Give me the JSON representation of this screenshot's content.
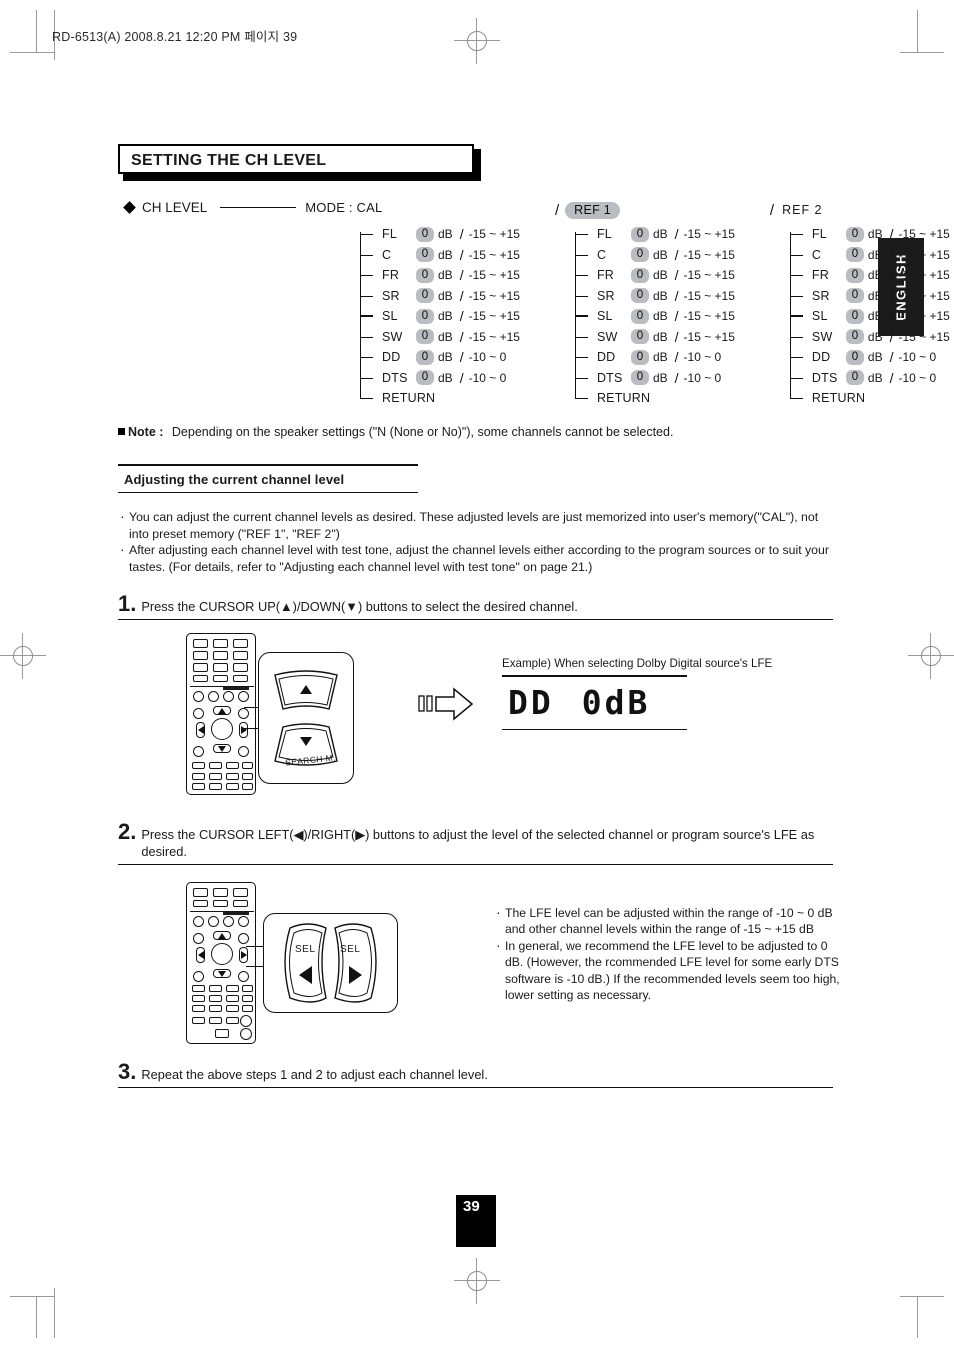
{
  "running_head": "RD-6513(A)  2008.8.21  12:20 PM  페이지 39",
  "section_title": "SETTING THE CH LEVEL",
  "side_tab": "ENGLISH",
  "ch_level": {
    "label": "CH LEVEL",
    "mode_label": "MODE  : CAL"
  },
  "columns": [
    {
      "header": "CAL",
      "header_style": "inline",
      "rows": [
        {
          "ch": "FL",
          "value": "0",
          "unit": "dB",
          "range": "-15 ~ +15"
        },
        {
          "ch": "C",
          "value": "0",
          "unit": "dB",
          "range": "-15 ~ +15"
        },
        {
          "ch": "FR",
          "value": "0",
          "unit": "dB",
          "range": "-15 ~ +15"
        },
        {
          "ch": "SR",
          "value": "0",
          "unit": "dB",
          "range": "-15 ~ +15"
        },
        {
          "ch": "SL",
          "value": "0",
          "unit": "dB",
          "range": "-15 ~ +15"
        },
        {
          "ch": "SW",
          "value": "0",
          "unit": "dB",
          "range": "-15 ~ +15"
        },
        {
          "ch": "DD",
          "value": "0",
          "unit": "dB",
          "range": "-10 ~ 0"
        },
        {
          "ch": "DTS",
          "value": "0",
          "unit": "dB",
          "range": "-10 ~ 0"
        }
      ],
      "return_label": "RETURN"
    },
    {
      "header": "REF 1",
      "header_style": "badge",
      "rows": [
        {
          "ch": "FL",
          "value": "0",
          "unit": "dB",
          "range": "-15 ~ +15"
        },
        {
          "ch": "C",
          "value": "0",
          "unit": "dB",
          "range": "-15 ~ +15"
        },
        {
          "ch": "FR",
          "value": "0",
          "unit": "dB",
          "range": "-15 ~ +15"
        },
        {
          "ch": "SR",
          "value": "0",
          "unit": "dB",
          "range": "-15 ~ +15"
        },
        {
          "ch": "SL",
          "value": "0",
          "unit": "dB",
          "range": "-15 ~ +15"
        },
        {
          "ch": "SW",
          "value": "0",
          "unit": "dB",
          "range": "-15 ~ +15"
        },
        {
          "ch": "DD",
          "value": "0",
          "unit": "dB",
          "range": "-10 ~ 0"
        },
        {
          "ch": "DTS",
          "value": "0",
          "unit": "dB",
          "range": "-10 ~ 0"
        }
      ],
      "return_label": "RETURN"
    },
    {
      "header": "REF 2",
      "header_style": "plain",
      "rows": [
        {
          "ch": "FL",
          "value": "0",
          "unit": "dB",
          "range": "-15 ~ +15"
        },
        {
          "ch": "C",
          "value": "0",
          "unit": "dB",
          "range": "-15 ~ +15"
        },
        {
          "ch": "FR",
          "value": "0",
          "unit": "dB",
          "range": "-15 ~ +15"
        },
        {
          "ch": "SR",
          "value": "0",
          "unit": "dB",
          "range": "-15 ~ +15"
        },
        {
          "ch": "SL",
          "value": "0",
          "unit": "dB",
          "range": "-15 ~ +15"
        },
        {
          "ch": "SW",
          "value": "0",
          "unit": "dB",
          "range": "-15 ~ +15"
        },
        {
          "ch": "DD",
          "value": "0",
          "unit": "dB",
          "range": "-10 ~ 0"
        },
        {
          "ch": "DTS",
          "value": "0",
          "unit": "dB",
          "range": "-10 ~ 0"
        }
      ],
      "return_label": "RETURN"
    }
  ],
  "note": {
    "label": "Note :",
    "text": "Depending on the speaker settings (\"N (None or No)\"), some channels cannot be selected."
  },
  "subsection": {
    "title": "Adjusting the current channel level"
  },
  "intro_bullets": [
    "You can adjust the current channel levels as desired. These adjusted levels are just memorized into user's memory(\"CAL\"), not into preset memory (\"REF 1\", \"REF 2\")",
    "After adjusting each channel level with test tone, adjust the channel levels either according to the program sources or to suit your tastes. (For details, refer to \"Adjusting each channel level with test tone\" on page 21.)"
  ],
  "steps": [
    {
      "num": "1.",
      "text": "Press the CURSOR UP(▲)/DOWN(▼) buttons to select the desired channel."
    },
    {
      "num": "2.",
      "text": "Press the CURSOR LEFT(◀)/RIGHT(▶) buttons to adjust the level of the selected channel or  program source's LFE as desired."
    },
    {
      "num": "3.",
      "text": "Repeat the above steps 1 and 2 to adjust each channel level."
    }
  ],
  "callout_step1": {
    "up_button": "",
    "down_button": "SEARCH M."
  },
  "callout_step2": {
    "left_label": "SEL",
    "right_label": "SEL"
  },
  "lcd_example": {
    "caption": "Example) When selecting Dolby Digital source's LFE",
    "display_left": "DD",
    "display_right": "0dB"
  },
  "step2_bullets": [
    "The LFE level can be adjusted within the range of -10 ~ 0 dB and other channel levels within the range of -15 ~ +15 dB",
    "In general, we recommend the LFE level to be adjusted to 0 dB. (However, the rcommended LFE level for some early DTS software is -10 dB.)  If the recommended levels seem too high, lower setting as necessary."
  ],
  "page_number": "39"
}
